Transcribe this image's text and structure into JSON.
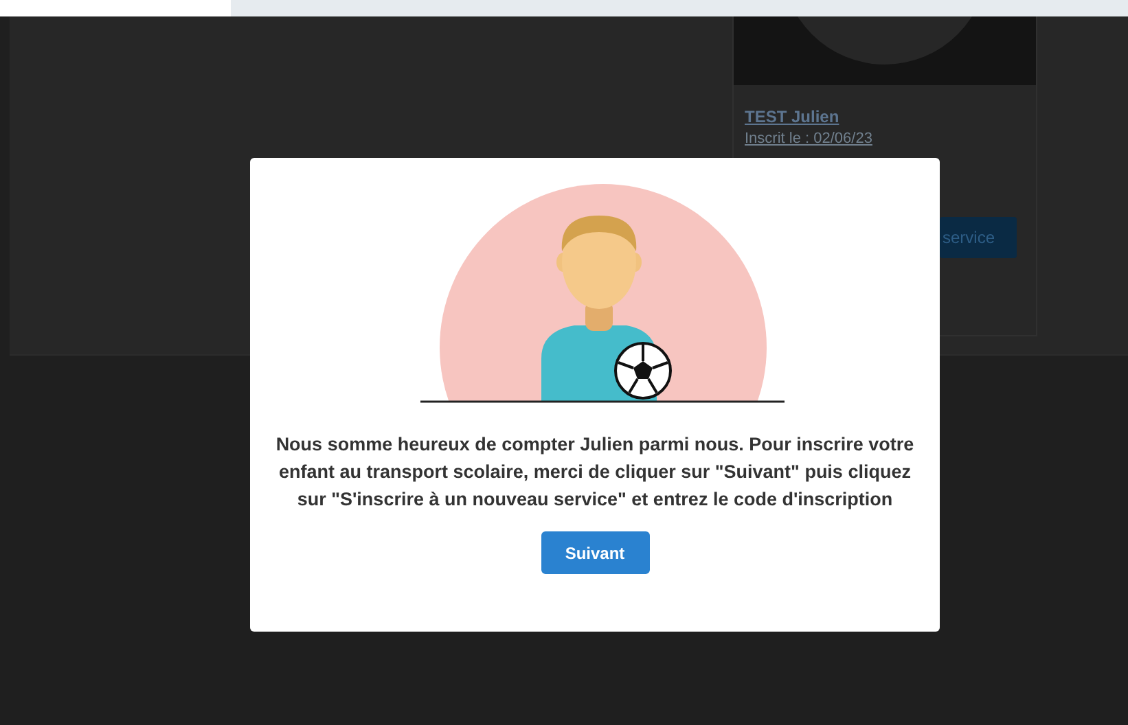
{
  "background_card": {
    "name": "TEST Julien",
    "registered": "Inscrit le : 02/06/23",
    "button": "service"
  },
  "modal": {
    "message": "Nous somme heureux de compter Julien parmi nous. Pour inscrire votre enfant au transport scolaire, merci de cliquer sur \"Suivant\" puis cliquez sur \"S'inscrire à un nouveau service\" et entrez le code d'inscription",
    "button": "Suivant"
  }
}
